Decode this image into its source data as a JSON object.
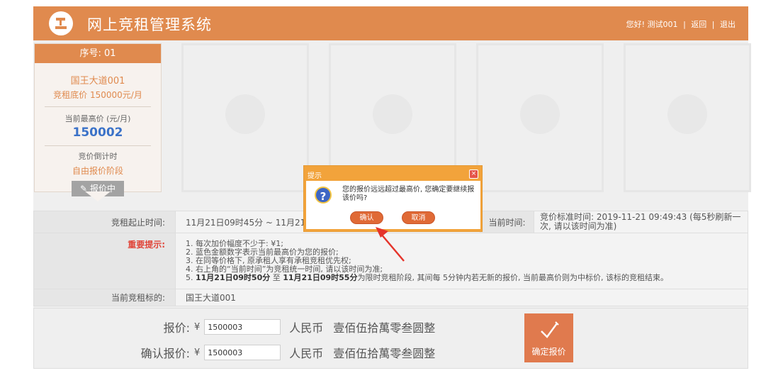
{
  "app": {
    "title": "网上竞租管理系统"
  },
  "user_bar": {
    "greeting": "您好! 测试001",
    "sep": "|",
    "back": "返回",
    "logout": "退出"
  },
  "lot": {
    "index_label": "序号: 01",
    "name": "国王大道001",
    "base_price": "竞租底价 150000元/月",
    "highest_label": "当前最高价 (元/月)",
    "highest_value": "150002",
    "countdown_label": "竞价倒计时",
    "phase": "自由报价阶段",
    "status": "报价中"
  },
  "info": {
    "period_label": "竞租起止时间:",
    "period_value": "11月21日09时45分 ~ 11月21",
    "current_time_label": "当前时间:",
    "current_time_value": "竞价标准时间: 2019-11-21 09:49:43 (每5秒刷新一次, 请以该时间为准)",
    "important_label": "重要提示:",
    "tips": [
      "1. 每次加价幅度不少于: ¥1;",
      "2. 蓝色金额数字表示当前最高价为您的报价;",
      "3. 在同等价格下, 原承租人享有承租竞租优先权;",
      "4. 右上角的“当前时间”为竞租统一时间, 请以该时间为准;"
    ],
    "tip5_part1": "5. ",
    "tip5_bold1": "11月21日09时50分",
    "tip5_mid": " 至 ",
    "tip5_bold2": "11月21日09时55分",
    "tip5_rest": "为限时竞租阶段, 其间每 5分钟内若无新的报价, 当前最高价则为中标价, 该标的竞租结束。",
    "target_label": "当前竞租标的:",
    "target_value": "国王大道001"
  },
  "bid": {
    "price_label": "报价:",
    "confirm_price_label": "确认报价:",
    "yen": "¥",
    "price_value": "1500003",
    "confirm_value": "1500003",
    "currency": "人民币",
    "amount_caps": "壹佰伍拾萬零叁圆整",
    "confirm_button": "确定报价"
  },
  "dialog": {
    "title": "提示",
    "close": "×",
    "message": "您的报价远远超过最高价, 您确定要继续报该价吗?",
    "ok": "确认",
    "cancel": "取消"
  },
  "colors": {
    "brand": "#e08a4e",
    "highlight_blue": "#3b72c8",
    "warning_red": "#e0463a",
    "dialog_orange": "#f2a33b"
  }
}
